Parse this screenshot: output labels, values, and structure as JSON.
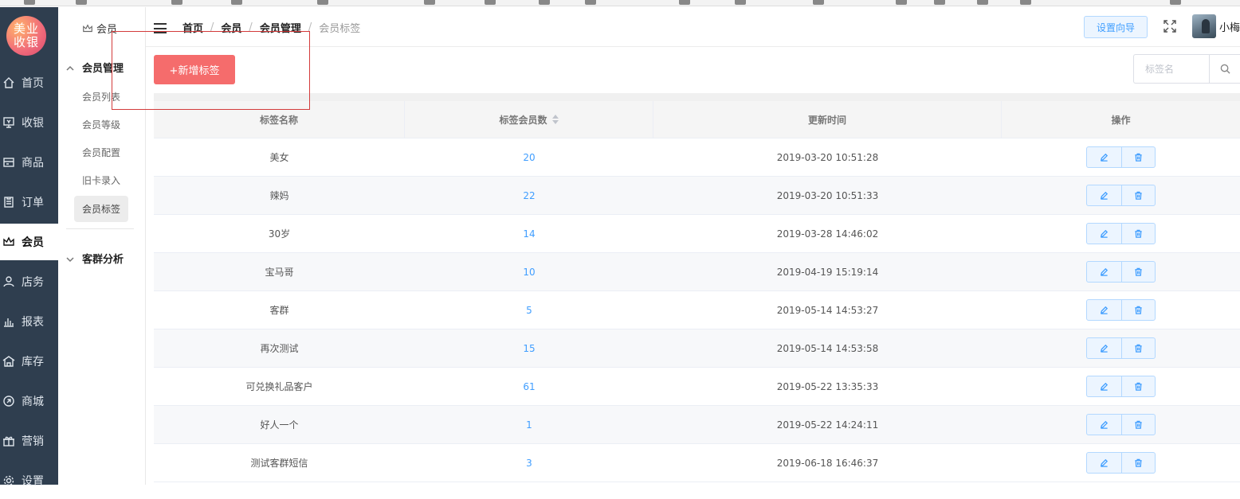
{
  "logo": {
    "line1": "美业",
    "line2": "收银"
  },
  "sidebar": {
    "items": [
      {
        "label": "首页",
        "icon": "home-icon"
      },
      {
        "label": "收银",
        "icon": "cashier-icon"
      },
      {
        "label": "商品",
        "icon": "goods-icon"
      },
      {
        "label": "订单",
        "icon": "order-icon"
      },
      {
        "label": "会员",
        "icon": "crown-icon",
        "active": true
      },
      {
        "label": "店务",
        "icon": "staff-icon"
      },
      {
        "label": "报表",
        "icon": "chart-icon"
      },
      {
        "label": "库存",
        "icon": "warehouse-icon"
      },
      {
        "label": "商城",
        "icon": "mall-icon"
      },
      {
        "label": "营销",
        "icon": "gift-icon"
      },
      {
        "label": "设置",
        "icon": "gear-icon"
      }
    ]
  },
  "submenu": {
    "title": "会员",
    "groups": [
      {
        "label": "会员管理",
        "expanded": true,
        "items": [
          "会员列表",
          "会员等级",
          "会员配置",
          "旧卡录入",
          "会员标签"
        ]
      },
      {
        "label": "客群分析",
        "expanded": false
      }
    ],
    "active_item": "会员标签"
  },
  "header": {
    "breadcrumb": [
      "首页",
      "会员",
      "会员管理",
      "会员标签"
    ],
    "guide_label": "设置向导",
    "username": "小梅"
  },
  "toolbar": {
    "add_label": "+新增标签",
    "search_placeholder": "标签名"
  },
  "table": {
    "columns": [
      "标签名称",
      "标签会员数",
      "更新时间",
      "操作"
    ],
    "rows": [
      {
        "name": "美女",
        "count": "20",
        "updated": "2019-03-20 10:51:28"
      },
      {
        "name": "辣妈",
        "count": "22",
        "updated": "2019-03-20 10:51:33"
      },
      {
        "name": "30岁",
        "count": "14",
        "updated": "2019-03-28 14:46:02"
      },
      {
        "name": "宝马哥",
        "count": "10",
        "updated": "2019-04-19 15:19:14"
      },
      {
        "name": "客群",
        "count": "5",
        "updated": "2019-05-14 14:53:27"
      },
      {
        "name": "再次测试",
        "count": "15",
        "updated": "2019-05-14 14:53:58"
      },
      {
        "name": "可兑换礼品客户",
        "count": "61",
        "updated": "2019-05-22 13:35:33"
      },
      {
        "name": "好人一个",
        "count": "1",
        "updated": "2019-05-22 14:24:11"
      },
      {
        "name": "测试客群短信",
        "count": "3",
        "updated": "2019-06-18 16:46:37"
      }
    ]
  },
  "colors": {
    "sidebar_bg": "#2f3e4f",
    "primary": "#409eff",
    "danger": "#f56c6c",
    "annotation": "#d33b3b"
  }
}
